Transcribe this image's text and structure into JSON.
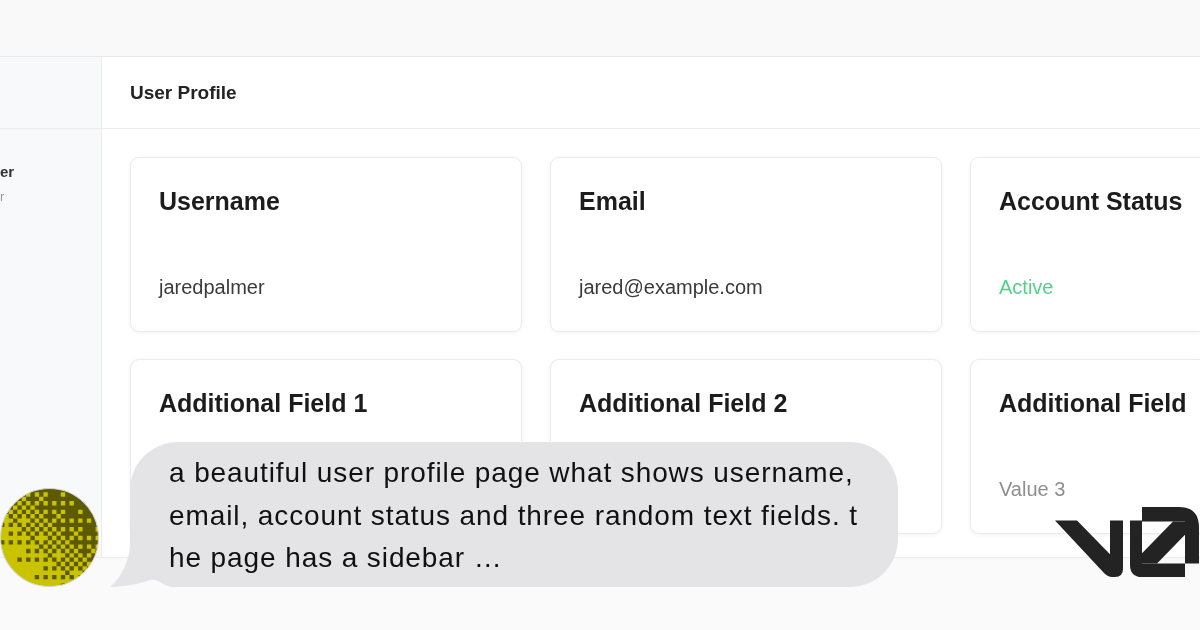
{
  "sidebar": {
    "lines": [
      {
        "text": "er",
        "kind": "strong"
      },
      {
        "text": "r",
        "kind": "muted"
      }
    ]
  },
  "header": {
    "title": "User Profile"
  },
  "cards": [
    {
      "title": "Username",
      "value": {
        "text": "jaredpalmer",
        "kind": "plain"
      }
    },
    {
      "title": "Email",
      "value": {
        "text": "jared@example.com",
        "kind": "plain"
      }
    },
    {
      "title": "Account Status",
      "value": {
        "text": "Active",
        "kind": "status"
      }
    },
    {
      "title": "Additional Field 1"
    },
    {
      "title": "Additional Field 2"
    },
    {
      "title": "Additional Field",
      "value": {
        "text": "Value 3",
        "kind": "muted"
      }
    }
  ],
  "chat": {
    "prompt_lines": [
      "a beautiful user profile page what shows username,",
      "email, account status and three random text fields. t",
      "he page has a sidebar …"
    ]
  }
}
